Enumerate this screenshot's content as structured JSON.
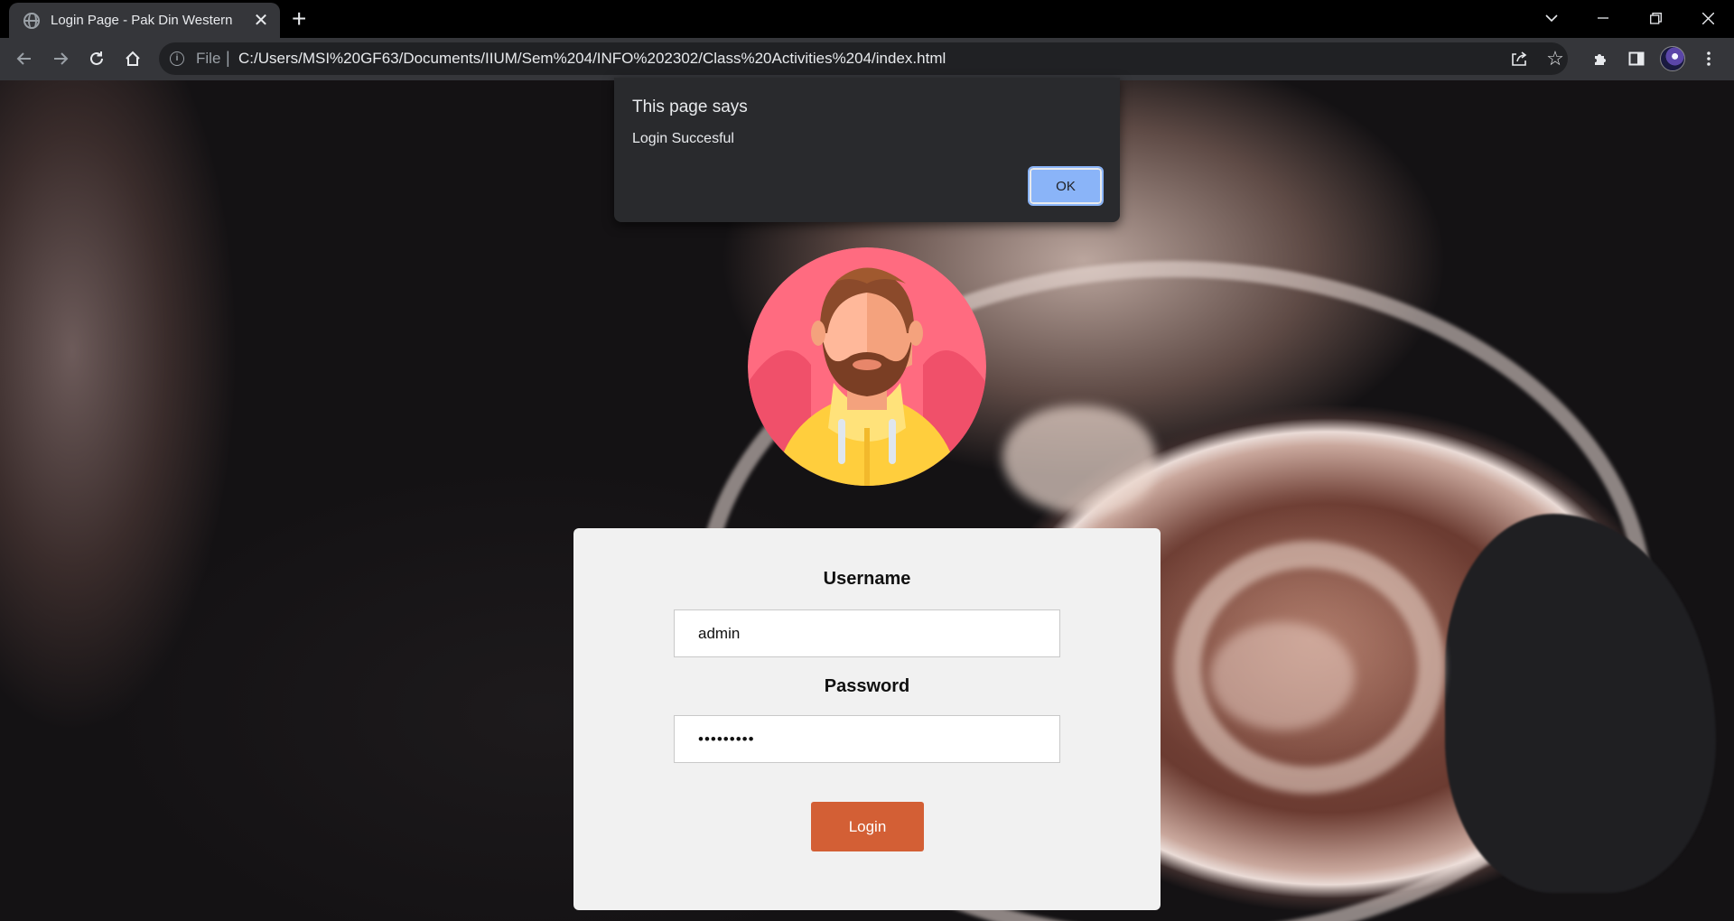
{
  "browser": {
    "tab_title": "Login Page - Pak Din Western",
    "new_tab": "+",
    "close_tab": "✕",
    "scheme_label": "File",
    "url": "C:/Users/MSI%20GF63/Documents/IIUM/Sem%204/INFO%202302/Class%20Activities%204/index.html"
  },
  "dialog": {
    "title": "This page says",
    "message": "Login Succesful",
    "ok_label": "OK"
  },
  "form": {
    "username_label": "Username",
    "username_value": "admin",
    "password_label": "Password",
    "password_value": "•••••••••",
    "login_label": "Login"
  },
  "colors": {
    "login_button": "#d35f35",
    "card_background": "#f1f1f1",
    "dialog_background": "#292a2d",
    "ok_button": "#8ab4f8"
  }
}
